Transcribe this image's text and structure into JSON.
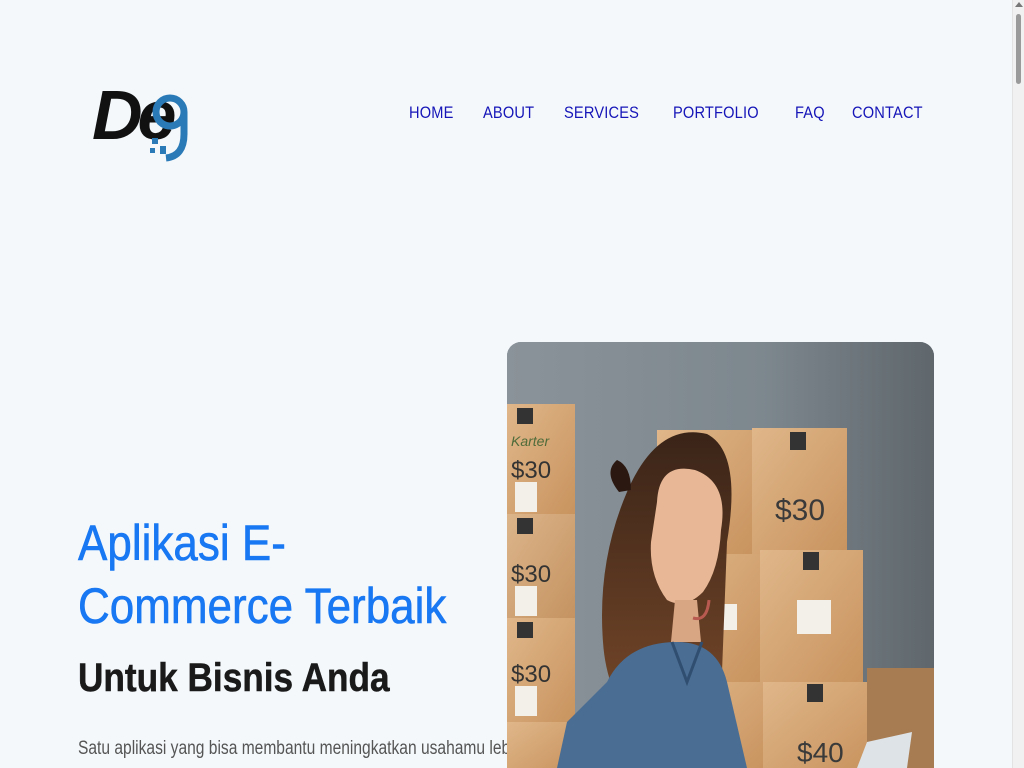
{
  "brand": {
    "logo_text": "De",
    "logo_mark": "9",
    "colors": {
      "dark": "#111111",
      "accent": "#2a7ab7"
    }
  },
  "nav": {
    "items": [
      {
        "label": "HOME"
      },
      {
        "label": "ABOUT"
      },
      {
        "label": "SERVICES"
      },
      {
        "label": "PORTFOLIO"
      },
      {
        "label": "FAQ"
      },
      {
        "label": "CONTACT"
      }
    ],
    "color": "#1515b8"
  },
  "hero": {
    "title": "Aplikasi E-Commerce Terbaik",
    "subtitle": "Untuk Bisnis Anda",
    "description": "Satu aplikasi yang bisa membantu meningkatkan usahamu lebih",
    "title_color": "#1877f2",
    "image": {
      "alt": "Woman with laptop in front of stacked cardboard boxes",
      "box_labels": [
        "Karter",
        "$30",
        "$30",
        "$40"
      ]
    }
  }
}
